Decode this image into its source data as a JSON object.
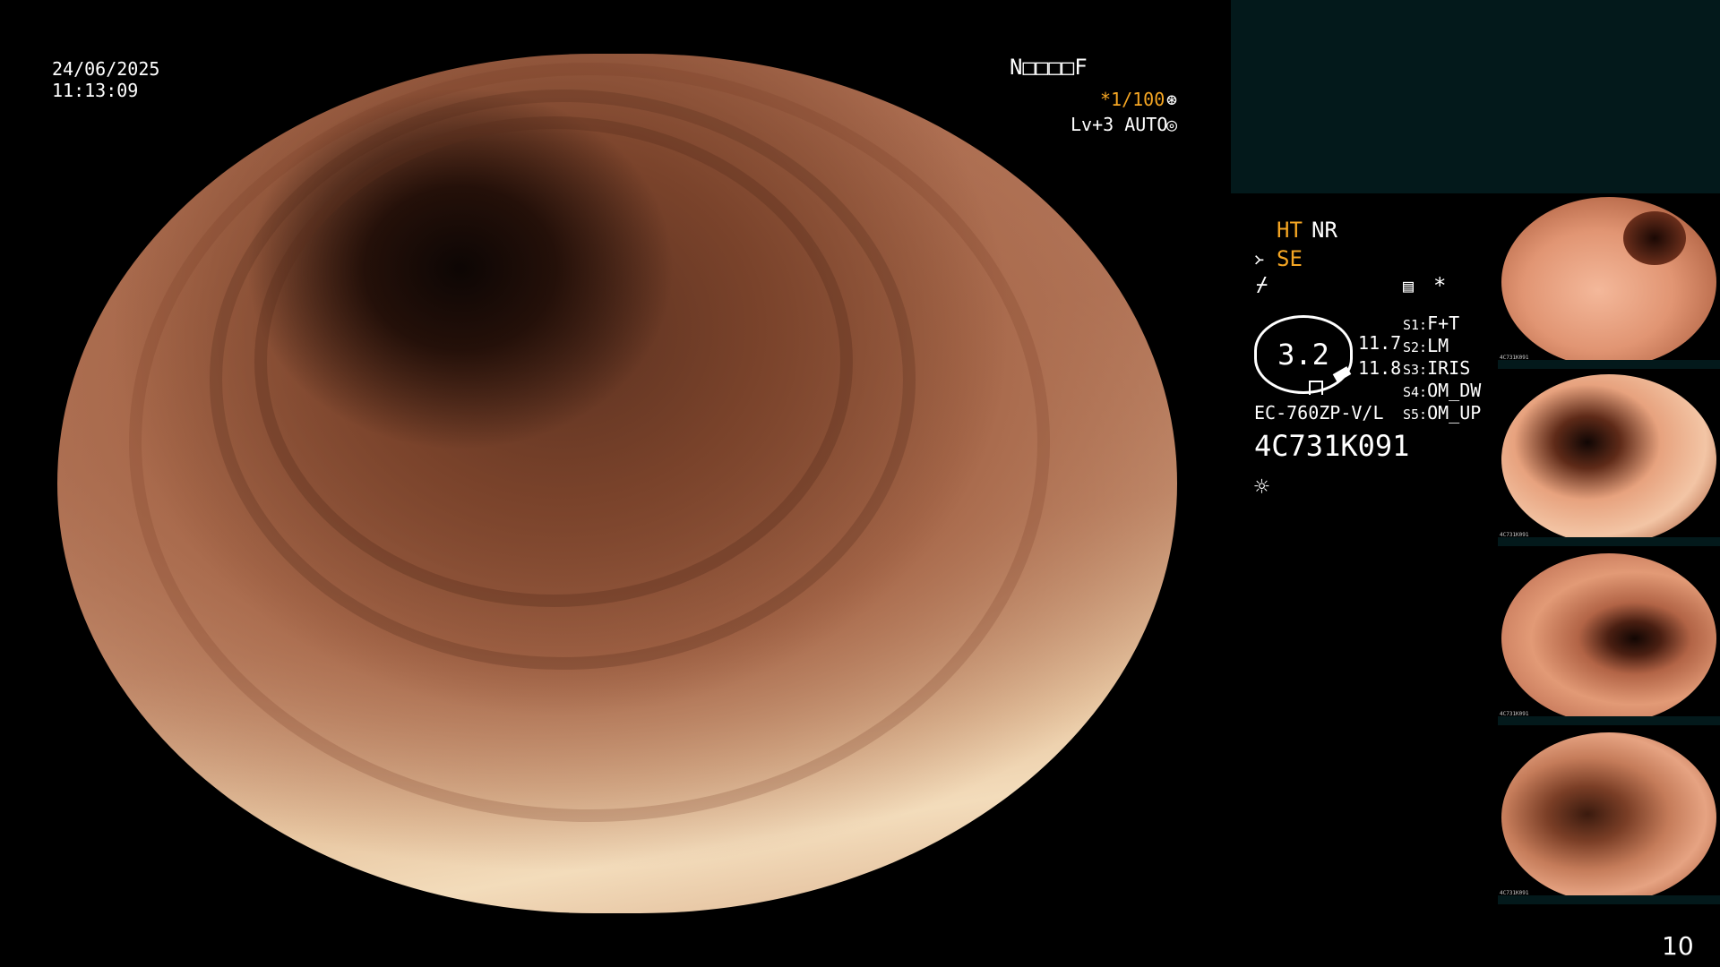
{
  "header": {
    "date": "24/06/2025",
    "time": "11:13:09",
    "mode_code": "N□□□□F",
    "shutter": "*1/100",
    "level": "Lv+3 AUTO"
  },
  "panel": {
    "ht": "HT",
    "nr": "NR",
    "se": "SE",
    "gauge_value": "3.2",
    "gauge_side_top": "11.7",
    "gauge_side_bottom": "11.8",
    "scope_model": "EC-760ZP-V/L",
    "serial": "4C731K091",
    "asterisk": "*",
    "switches": [
      {
        "key": "S1:",
        "value": "F+T"
      },
      {
        "key": "S2:",
        "value": "LM"
      },
      {
        "key": "S3:",
        "value": "IRIS"
      },
      {
        "key": "S4:",
        "value": "OM_DW"
      },
      {
        "key": "S5:",
        "value": "OM_UP"
      }
    ]
  },
  "thumbnails": [
    {
      "serial": "4C731K091"
    },
    {
      "serial": "4C731K091"
    },
    {
      "serial": "4C731K091"
    },
    {
      "serial": "4C731K091"
    }
  ],
  "footer": {
    "page_number": "10"
  },
  "colors": {
    "accent": "#f5a623",
    "panel_box": "#03191b"
  }
}
